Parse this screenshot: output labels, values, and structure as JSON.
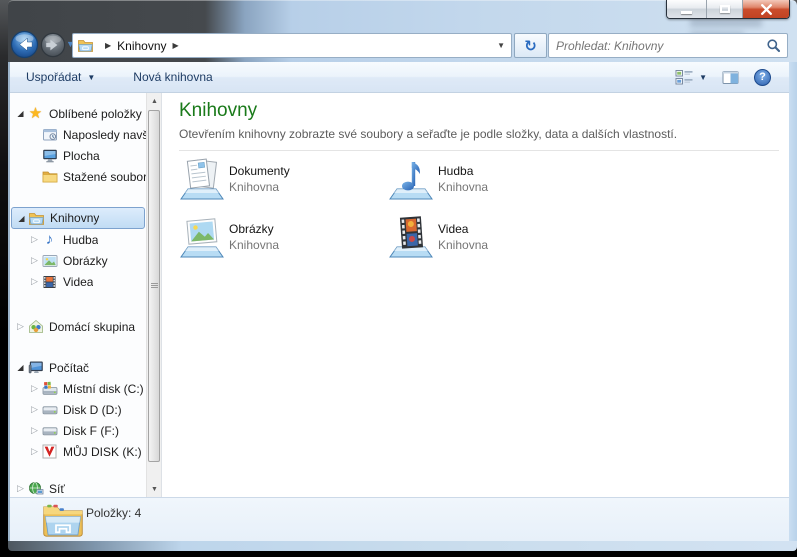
{
  "window": {
    "controls": [
      {
        "name": "minimize"
      },
      {
        "name": "restore"
      },
      {
        "name": "close"
      }
    ]
  },
  "address_bar": {
    "breadcrumb": [
      "Knihovny"
    ]
  },
  "search": {
    "placeholder": "Prohledat: Knihovny"
  },
  "toolbar": {
    "organize_label": "Uspořádat",
    "new_library_label": "Nová knihovna"
  },
  "sidebar": {
    "items": [
      {
        "label": "Oblíbené položky",
        "state": "expanded",
        "icon": "star"
      },
      {
        "label": "Naposledy navštívené",
        "state": "none",
        "icon": "recent-places"
      },
      {
        "label": "Plocha",
        "state": "none",
        "icon": "desktop"
      },
      {
        "label": "Stažené soubory",
        "state": "none",
        "icon": "downloads-folder"
      },
      {
        "label": "Knihovny",
        "state": "expanded",
        "icon": "libraries-folder",
        "selected": true
      },
      {
        "label": "Hudba",
        "state": "collapsed",
        "icon": "music"
      },
      {
        "label": "Obrázky",
        "state": "collapsed",
        "icon": "pictures"
      },
      {
        "label": "Videa",
        "state": "collapsed",
        "icon": "videos"
      },
      {
        "label": "Domácí skupina",
        "state": "collapsed",
        "icon": "homegroup"
      },
      {
        "label": "Počítač",
        "state": "expanded",
        "icon": "computer"
      },
      {
        "label": "Místní disk (C:)",
        "state": "collapsed",
        "icon": "system-disk"
      },
      {
        "label": "Disk D (D:)",
        "state": "collapsed",
        "icon": "disk"
      },
      {
        "label": "Disk F (F:)",
        "state": "collapsed",
        "icon": "disk"
      },
      {
        "label": "MŮJ DISK (K:)",
        "state": "collapsed",
        "icon": "disk-v"
      },
      {
        "label": "Síť",
        "state": "collapsed",
        "icon": "network"
      }
    ]
  },
  "main": {
    "title": "Knihovny",
    "subtitle": "Otevřením knihovny zobrazte své soubory a seřaďte je podle složky, data a dalších vlastností.",
    "items": [
      {
        "name": "Dokumenty",
        "type": "Knihovna"
      },
      {
        "name": "Hudba",
        "type": "Knihovna"
      },
      {
        "name": "Obrázky",
        "type": "Knihovna"
      },
      {
        "name": "Videa",
        "type": "Knihovna"
      }
    ]
  },
  "statusbar": {
    "items_label": "Položky: 4"
  },
  "glyphs": {
    "dropdown": "▼",
    "breadcrumb_sep": "▶",
    "collapsed": "▷",
    "expanded": "◢",
    "refresh": "↻",
    "star": "★",
    "note": "♪",
    "help": "?",
    "scroll_up": "▲",
    "scroll_down": "▼"
  },
  "colors": {
    "heading_green": "#1a7a1a",
    "glass_blue": "#c2d7ec",
    "close_red": "#c14322",
    "selection_border": "#7da2ce"
  }
}
